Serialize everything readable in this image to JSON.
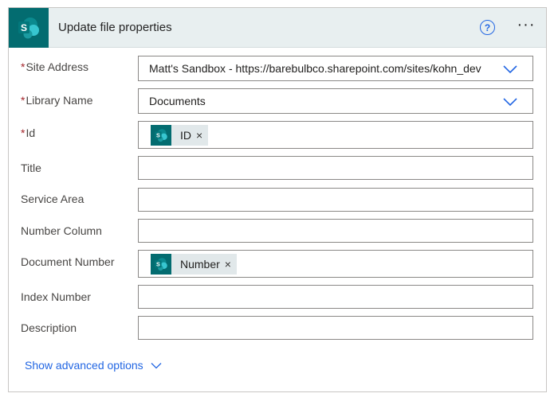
{
  "header": {
    "title": "Update file properties",
    "help_label": "?",
    "more_label": "···"
  },
  "fields": {
    "site_address": {
      "label": "Site Address",
      "required_mark": "*",
      "value": "Matt's Sandbox - https://barebulbco.sharepoint.com/sites/kohn_dev"
    },
    "library_name": {
      "label": "Library Name",
      "required_mark": "*",
      "value": "Documents"
    },
    "id": {
      "label": "Id",
      "required_mark": "*",
      "token": "ID",
      "remove": "×"
    },
    "title": {
      "label": "Title"
    },
    "service_area": {
      "label": "Service Area"
    },
    "number_column": {
      "label": "Number Column"
    },
    "document_number": {
      "label": "Document Number",
      "token": "Number",
      "remove": "×"
    },
    "index_number": {
      "label": "Index Number"
    },
    "description": {
      "label": "Description"
    }
  },
  "advanced": {
    "label": "Show advanced options"
  },
  "colors": {
    "sharepoint_teal": "#036c70",
    "header_bg": "#e8eff0",
    "accent_blue": "#2266e3",
    "required_red": "#a4262c"
  },
  "icons": {
    "app": "sharepoint-icon",
    "help": "help-circle-icon",
    "more": "ellipsis-icon",
    "dropdown": "chevron-down-icon",
    "token": "sharepoint-icon",
    "remove": "close-icon"
  }
}
